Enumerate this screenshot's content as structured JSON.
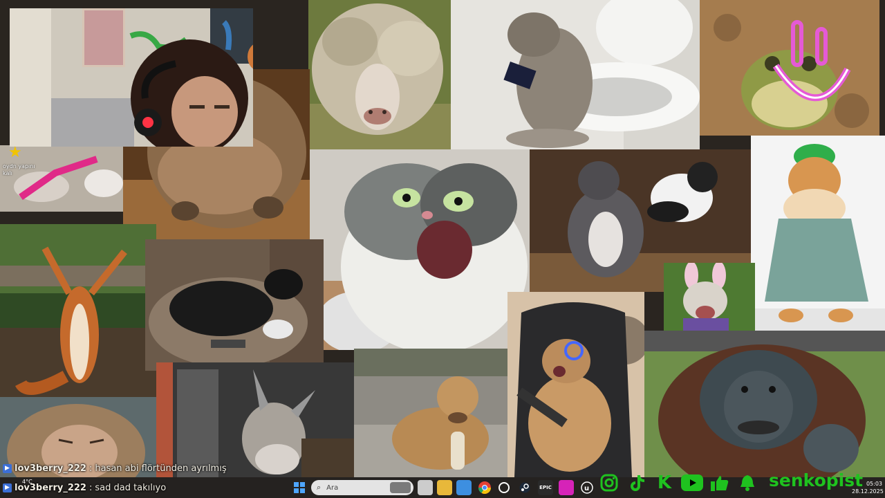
{
  "colors": {
    "accent_green": "#1fc21f",
    "chat_text": "#f3efe4",
    "chat_badge": "#3b6fd6",
    "taskbar": "#202020",
    "star": "#f2c400",
    "face_pink": "#e55ad5"
  },
  "overlay": {
    "alert_text": "oydn yapını\nkalı",
    "weather": "4°C"
  },
  "chat": [
    {
      "username": "lov3berry_222",
      "separator": ":",
      "message": "hasan abi flörtünden ayrılmış"
    },
    {
      "username": "lov3berry_222",
      "separator": ":",
      "message": "sad dad takılıyo"
    }
  ],
  "taskbar": {
    "search_placeholder": "Ara",
    "icons": [
      "windows-start-icon",
      "search-icon",
      "task-view-icon",
      "file-explorer-icon",
      "store-icon",
      "chrome-icon",
      "chatgpt-icon",
      "steam-icon",
      "epic-games-icon",
      "app-icon",
      "unreal-icon"
    ],
    "epic_label": "EPIC",
    "time": "05:03",
    "date": "28.12.2025"
  },
  "socials": {
    "icons": [
      "instagram-icon",
      "tiktok-icon",
      "kick-icon",
      "youtube-icon",
      "like-icon",
      "bell-icon"
    ],
    "kick_letter": "K",
    "brand": "senkopist"
  },
  "collage": [
    "long-haired-sheep",
    "cat-on-toilet-with-phone",
    "frog-with-smiley-face",
    "fluffy-dog",
    "screaming-cat",
    "dog-and-cat-fighting",
    "cat-in-green-hat",
    "squirrel-arms-up",
    "black-dog-with-controller",
    "bunny-ears-bulldog",
    "orangutan",
    "monkey-face",
    "donkey",
    "dog-chewing-bread",
    "cat-gaming-chair-keyboard",
    "pink-toy-pet"
  ]
}
